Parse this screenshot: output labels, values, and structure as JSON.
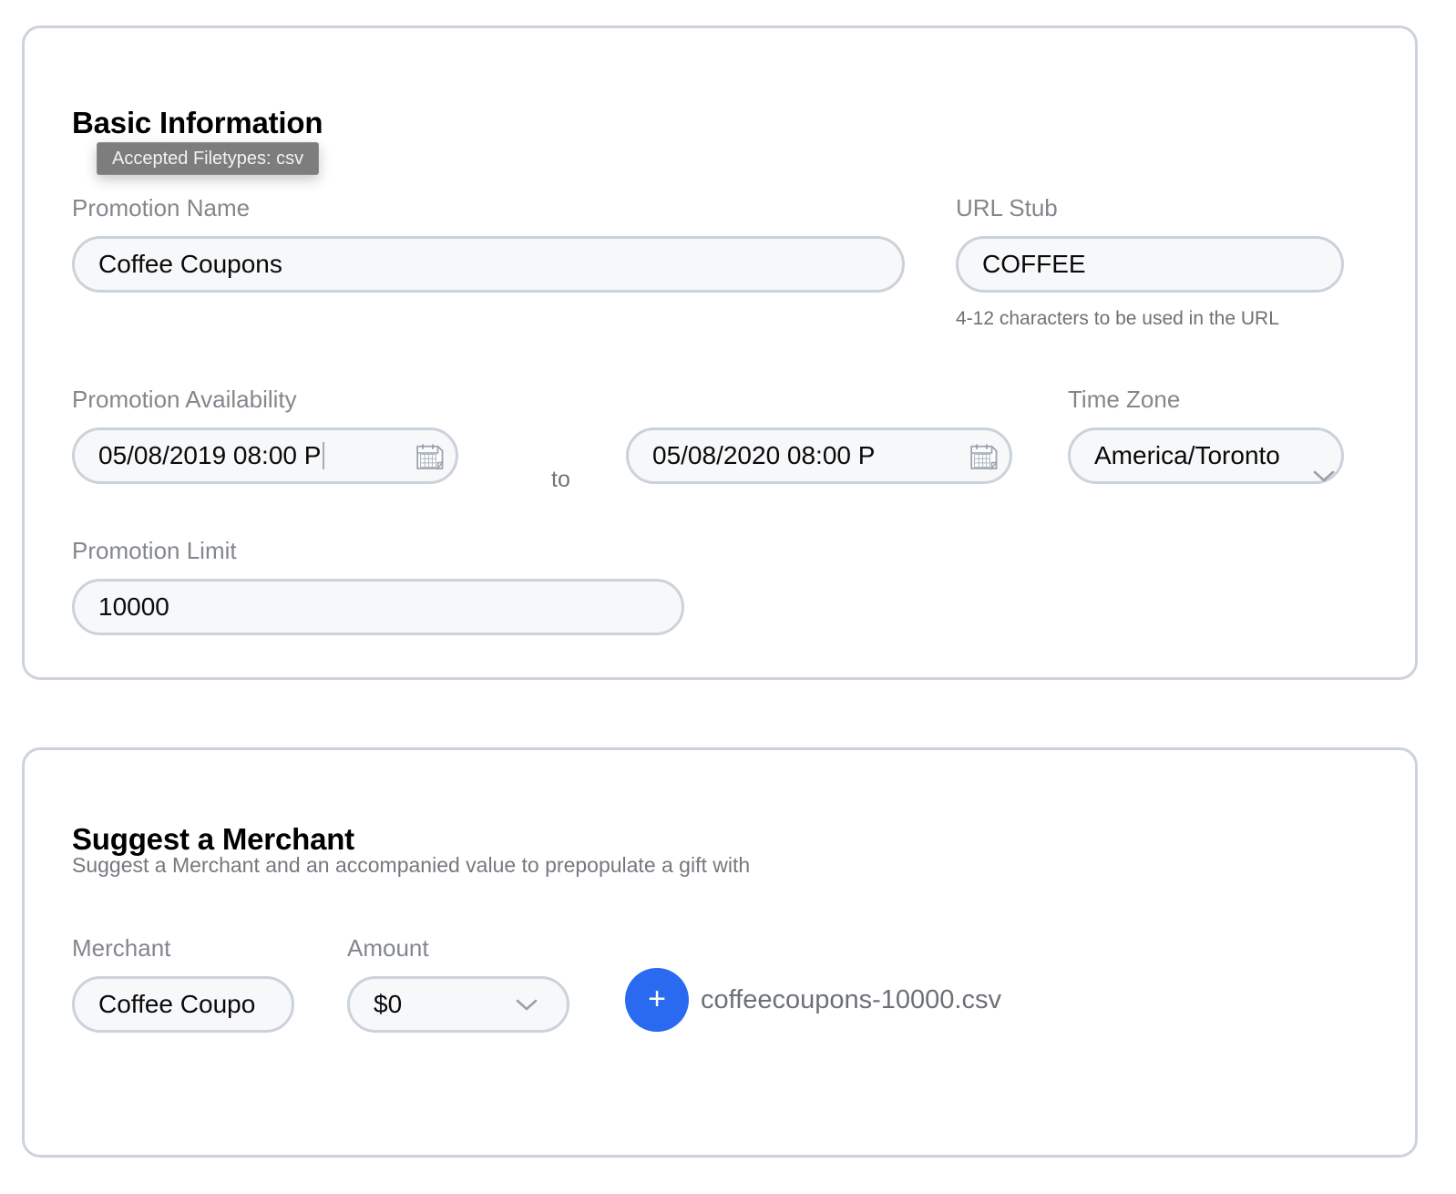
{
  "theme": {
    "accent": "#2a6af0",
    "card_border": "#ccd3da",
    "input_bg": "#f7f8fa",
    "input_border": "#ccd2da",
    "label_color": "#83878d",
    "tooltip_bg": "#7d7d7d"
  },
  "tooltip": {
    "text": "Accepted Filetypes: csv"
  },
  "basic_information": {
    "title": "Basic Information",
    "promotion_name": {
      "label": "Promotion Name",
      "value": "Coffee Coupons",
      "placeholder": "Promotion Name"
    },
    "url_stub": {
      "label": "URL Stub",
      "value": "COFFEE",
      "placeholder": "URL Stub",
      "help": "4-12 characters to be used in the URL"
    },
    "promotion_availability": {
      "label": "Promotion Availability",
      "separator": "to",
      "start": {
        "value": "05/08/2019 08:00 P",
        "placeholder": "mm/dd/yyyy hh:mm aa",
        "icon": "calendar-icon"
      },
      "end": {
        "value": "05/08/2020 08:00 P",
        "placeholder": "mm/dd/yyyy hh:mm aa",
        "icon": "calendar-icon"
      }
    },
    "time_zone": {
      "label": "Time Zone",
      "value": "America/Toronto",
      "options": [
        "America/Toronto"
      ],
      "icon": "chevron-down-icon"
    },
    "promotion_limit": {
      "label": "Promotion Limit",
      "value": "10000",
      "placeholder": "Promotion Limit"
    }
  },
  "suggest_a_merchant": {
    "title": "Suggest a Merchant",
    "subtitle": "Suggest a Merchant and an accompanied value to prepopulate a gift with",
    "merchant": {
      "label": "Merchant",
      "value": "Coffee Coupo",
      "placeholder": "Merchant"
    },
    "amount": {
      "label": "Amount",
      "value": "$0",
      "options": [
        "$0"
      ],
      "icon": "chevron-down-icon"
    },
    "add_button": {
      "label": "+",
      "icon": "plus-icon"
    },
    "file": {
      "name": "coffeecoupons-10000.csv"
    }
  }
}
